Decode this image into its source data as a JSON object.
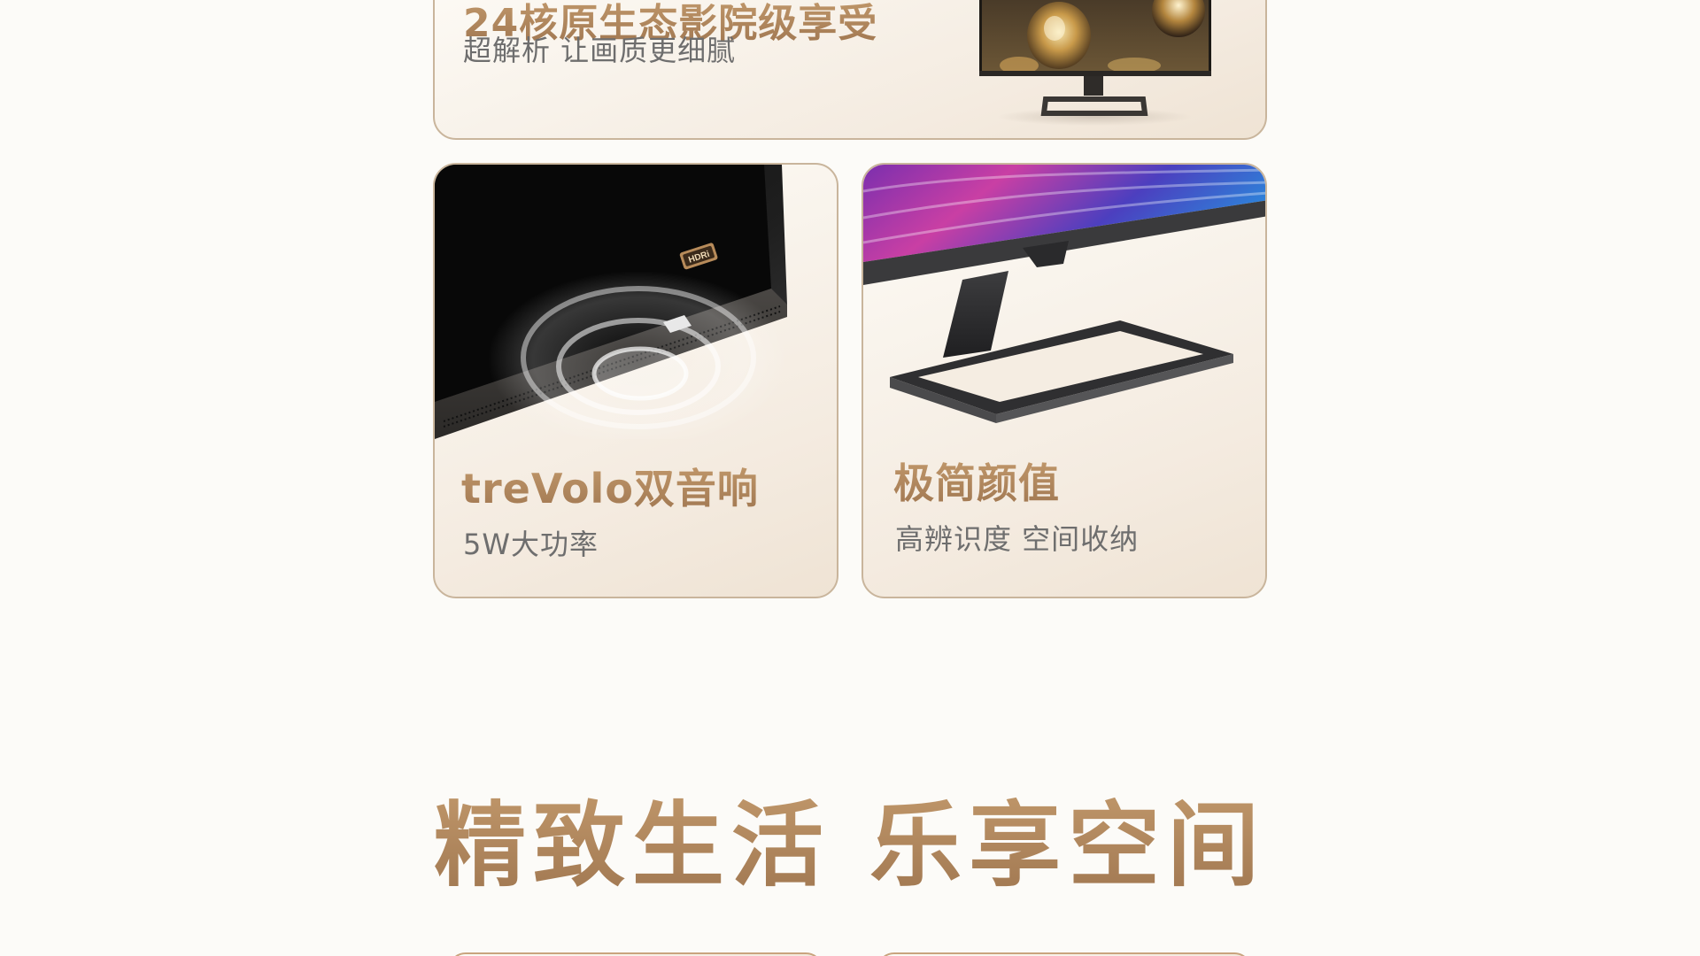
{
  "top_card": {
    "title": "24核原生态影院级享受",
    "subtitle": "超解析 让画质更细腻",
    "image": "monitor-front-icon"
  },
  "feature_cards": [
    {
      "title": "treVolo双音响",
      "subtitle": "5W大功率",
      "image": "speaker-icon",
      "badge": "HDRi"
    },
    {
      "title": "极简颜值",
      "subtitle": "高辨识度 空间收纳",
      "image": "monitor-stand-icon"
    }
  ],
  "section": {
    "heading": "精致生活 乐享空间"
  },
  "colors": {
    "accent_gold": "#b08560",
    "card_border": "#c9b59c",
    "background": "#fcfbf8",
    "subtitle_gray": "#6e6e6e"
  }
}
